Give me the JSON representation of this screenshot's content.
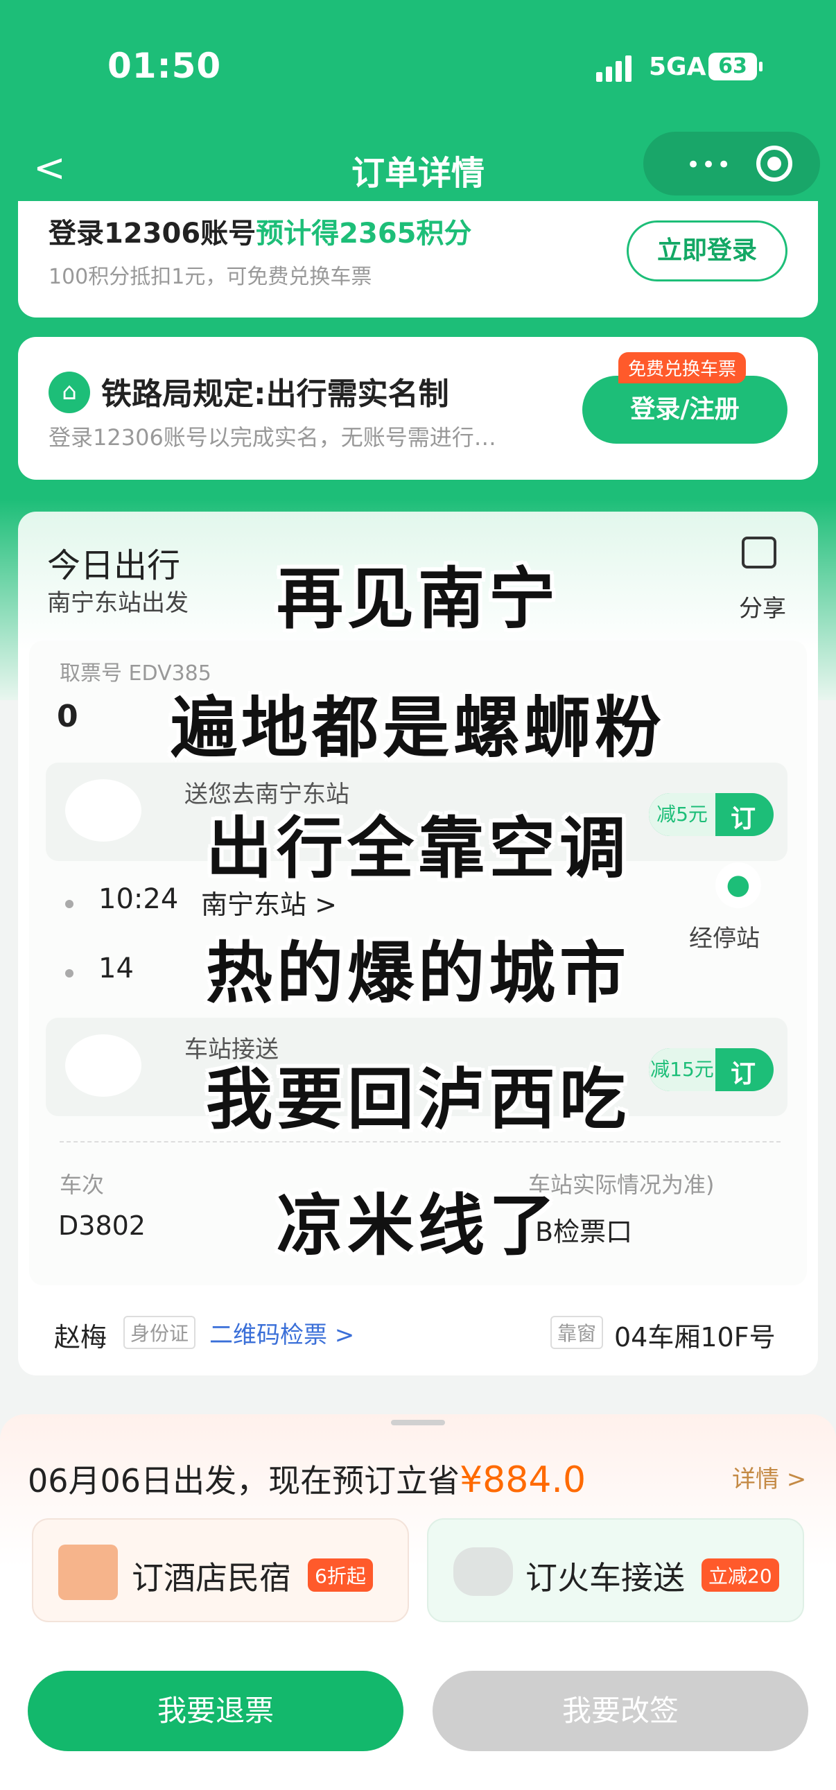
{
  "status_bar": {
    "time": "01:50",
    "network": "5GA",
    "battery": "63"
  },
  "nav": {
    "back": "<",
    "title": "订单详情",
    "more": "•••"
  },
  "login_card": {
    "title_prefix": "登录12306账号",
    "title_highlight": "预计得2365积分",
    "subtitle": "100积分抵扣1元，可免费兑换车票",
    "button": "立即登录"
  },
  "realname_card": {
    "title": "铁路局规定:出行需实名制",
    "subtitle": "登录12306账号以完成实名，无账号需进行…",
    "badge": "免费兑换车票",
    "button": "登录/注册"
  },
  "trip_card": {
    "title": "今日出行",
    "subtitle": "南宁东站出发",
    "share": "分享",
    "ticket_no_label": "取票号 EDV",
    "ticket_no_tail": "385",
    "ticket_no_value": "0",
    "taxi1": {
      "label": "送您去南宁东站",
      "discount": "减5元",
      "button": "订"
    },
    "stop1": {
      "time": "10:24",
      "station": "南宁东站 >"
    },
    "stop2": {
      "time": "14"
    },
    "stops_label": "经停站",
    "taxi2": {
      "label": "车站接送",
      "discount": "减15元",
      "button": "订"
    },
    "train_label": "车次",
    "train_no": "D3802",
    "gate_note": "车站实际情况为准)",
    "gate_value": "B检票口",
    "passenger": "赵梅",
    "id_type": "身份证",
    "qr_check": "二维码检票 >",
    "seat_type": "靠窗",
    "seat": "04车厢10F号"
  },
  "overlay": [
    "再见南宁",
    "遍地都是螺蛳粉",
    "出行全靠空调",
    "热的爆的城市",
    "我要回泸西吃",
    "凉米线了"
  ],
  "bottom": {
    "date_text": "06月06日出发，现在预订立省",
    "save_amount": "¥884.0",
    "details": "详情 >",
    "hotel_label": "订酒店民宿",
    "hotel_badge": "6折起",
    "car_label": "订火车接送",
    "car_badge": "立减20",
    "refund": "我要退票",
    "change": "我要改签"
  },
  "colors": {
    "brand_green": "#1dbe78",
    "orange": "#ff6a00",
    "blue_link": "#3a6fd8"
  }
}
